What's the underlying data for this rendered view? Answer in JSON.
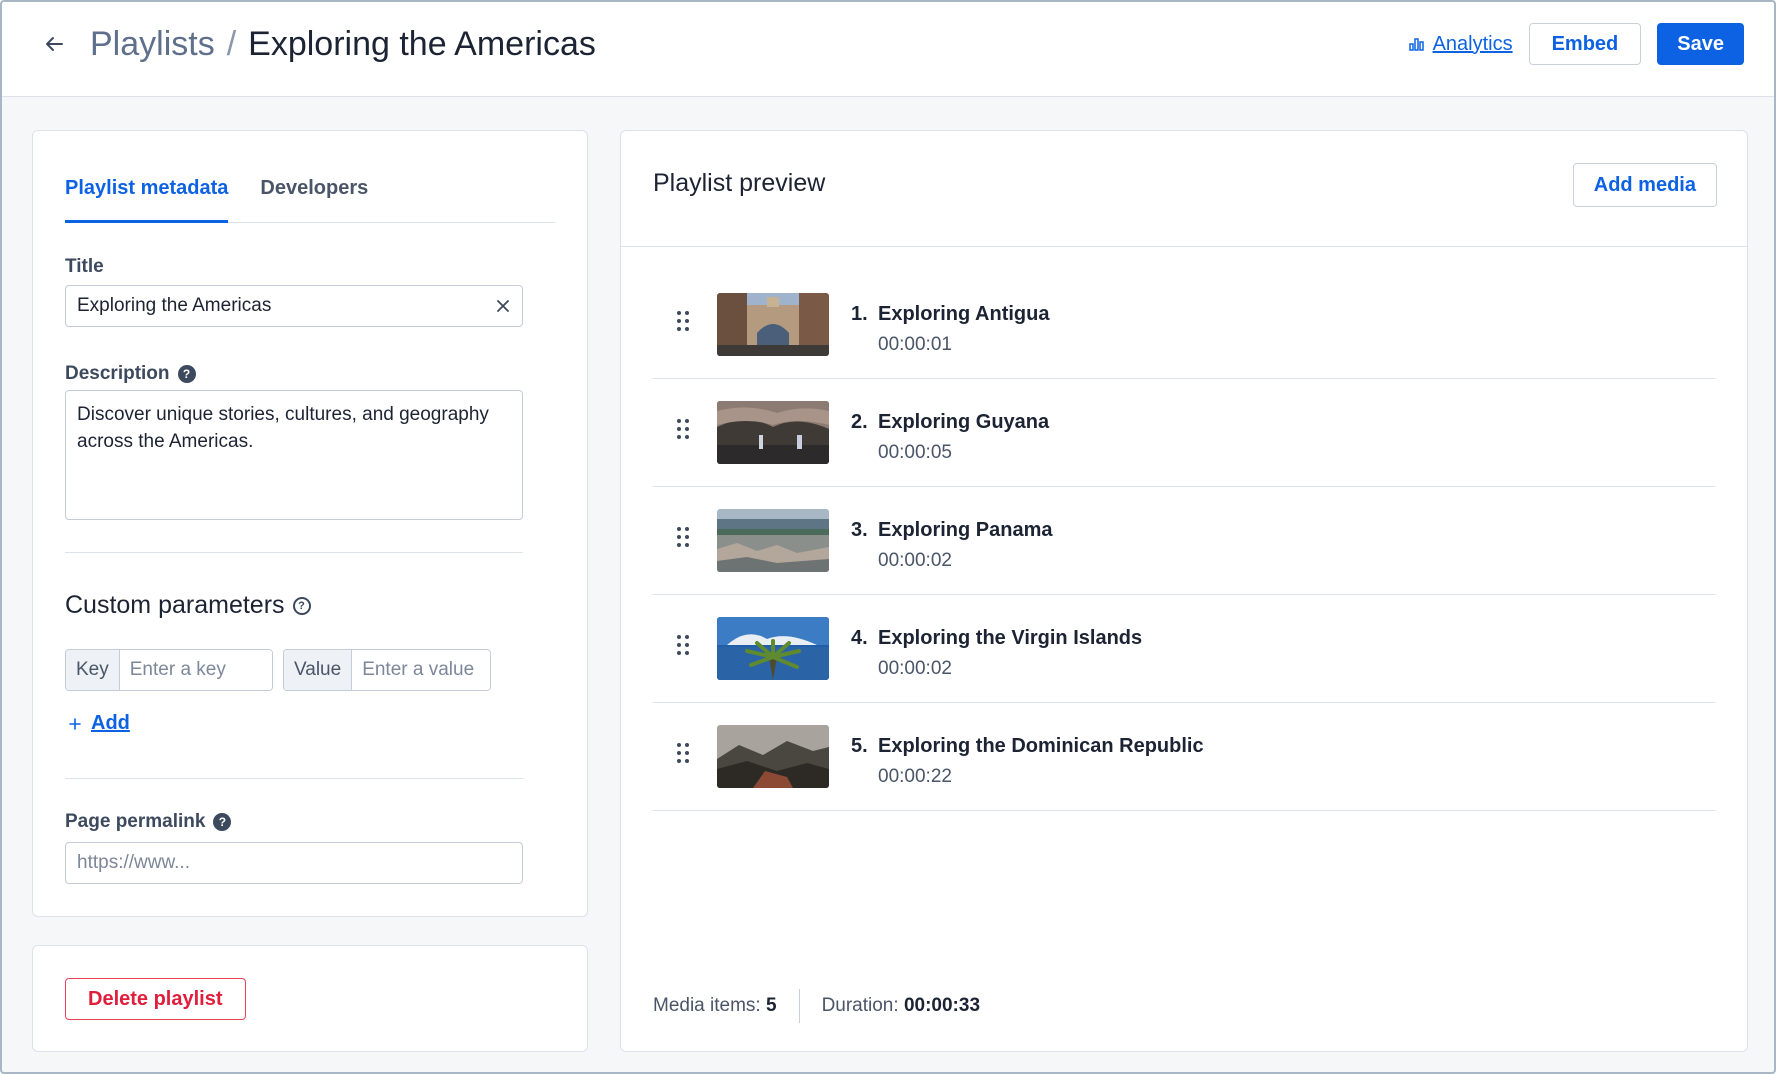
{
  "header": {
    "breadcrumb_parent": "Playlists",
    "breadcrumb_sep": "/",
    "title": "Exploring the Americas",
    "analytics_label": "Analytics",
    "embed_label": "Embed",
    "save_label": "Save"
  },
  "metadata": {
    "tabs": [
      {
        "label": "Playlist metadata",
        "active": true
      },
      {
        "label": "Developers",
        "active": false
      }
    ],
    "title_label": "Title",
    "title_value": "Exploring the Americas",
    "description_label": "Description",
    "description_value": "Discover unique stories, cultures, and geography across the Americas.",
    "custom_params_title": "Custom parameters",
    "key_addon": "Key",
    "key_placeholder": "Enter a key",
    "value_addon": "Value",
    "value_placeholder": "Enter a value",
    "add_label": "Add",
    "permalink_label": "Page permalink",
    "permalink_placeholder": "https://www..."
  },
  "danger": {
    "delete_label": "Delete playlist"
  },
  "preview": {
    "title": "Playlist preview",
    "add_media_label": "Add media",
    "items": [
      {
        "num": "1.",
        "title": "Exploring Antigua",
        "duration": "00:00:01"
      },
      {
        "num": "2.",
        "title": "Exploring Guyana",
        "duration": "00:00:05"
      },
      {
        "num": "3.",
        "title": "Exploring Panama",
        "duration": "00:00:02"
      },
      {
        "num": "4.",
        "title": "Exploring the Virgin Islands",
        "duration": "00:00:02"
      },
      {
        "num": "5.",
        "title": "Exploring the Dominican Republic",
        "duration": "00:00:22"
      }
    ],
    "media_items_label": "Media items",
    "media_items_count": "5",
    "duration_label": "Duration",
    "duration_total": "00:00:33"
  },
  "colors": {
    "accent": "#0d62e3",
    "danger": "#e01e3c",
    "border": "#dde2e9"
  },
  "icons": {
    "back": "arrow-left-icon",
    "clear": "close-icon",
    "help": "question-circle-icon",
    "analytics": "bar-chart-icon",
    "add": "plus-icon",
    "drag": "drag-handle-icon"
  }
}
